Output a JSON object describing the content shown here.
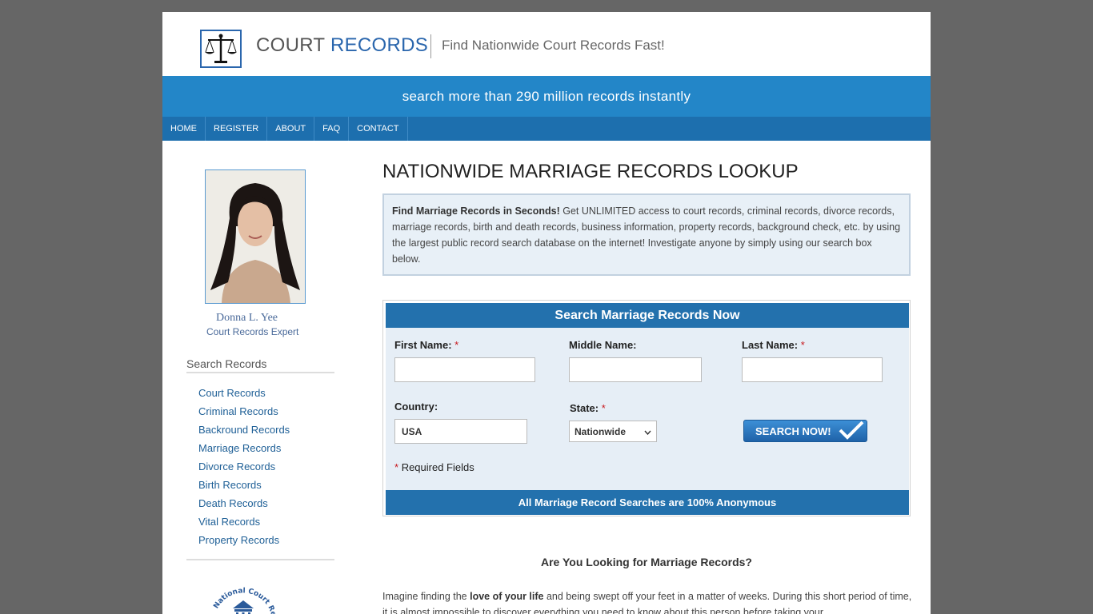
{
  "header": {
    "logo_word1": "COURT",
    "logo_word2": "RECORDS",
    "tagline": "Find Nationwide Court Records Fast!",
    "logo_icon": "scales-of-justice-icon"
  },
  "banner": {
    "text": "search more than 290 million records instantly"
  },
  "nav": [
    "HOME",
    "REGISTER",
    "ABOUT",
    "FAQ",
    "CONTACT"
  ],
  "sidebar": {
    "expert_name": "Donna L. Yee",
    "expert_title": "Court Records Expert",
    "heading": "Search Records",
    "links": [
      "Court Records",
      "Criminal Records",
      "Backround Records",
      "Marriage Records",
      "Divorce Records",
      "Birth Records",
      "Death Records",
      "Vital Records",
      "Property Records"
    ],
    "seal_text": "National Court Records"
  },
  "main": {
    "title": "NATIONWIDE MARRIAGE RECORDS LOOKUP",
    "intro_bold": "Find Marriage Records in Seconds!",
    "intro_text": " Get UNLIMITED access to court records, criminal records, divorce records, marriage records, birth and death records, business information, property records, background check, etc. by using the largest public record search database on the internet! Investigate anyone by simply using our search box below."
  },
  "form": {
    "heading": "Search Marriage Records Now",
    "first_name_label": "First Name:",
    "middle_name_label": "Middle Name:",
    "last_name_label": "Last Name:",
    "country_label": "Country:",
    "country_value": "USA",
    "state_label": "State:",
    "state_value": "Nationwide",
    "required_mark": "*",
    "search_button": "SEARCH NOW!",
    "required_note": "Required Fields",
    "footer": "All Marriage Record Searches are 100% Anonymous"
  },
  "article": {
    "subtitle": "Are You Looking for Marriage Records?",
    "p1_start": "Imagine finding the ",
    "p1_bold": "love of your life",
    "p1_end": " and being swept off your feet in a matter of weeks. During this short period of time, it is almost impossible to discover everything you need to know about this person before taking your"
  }
}
